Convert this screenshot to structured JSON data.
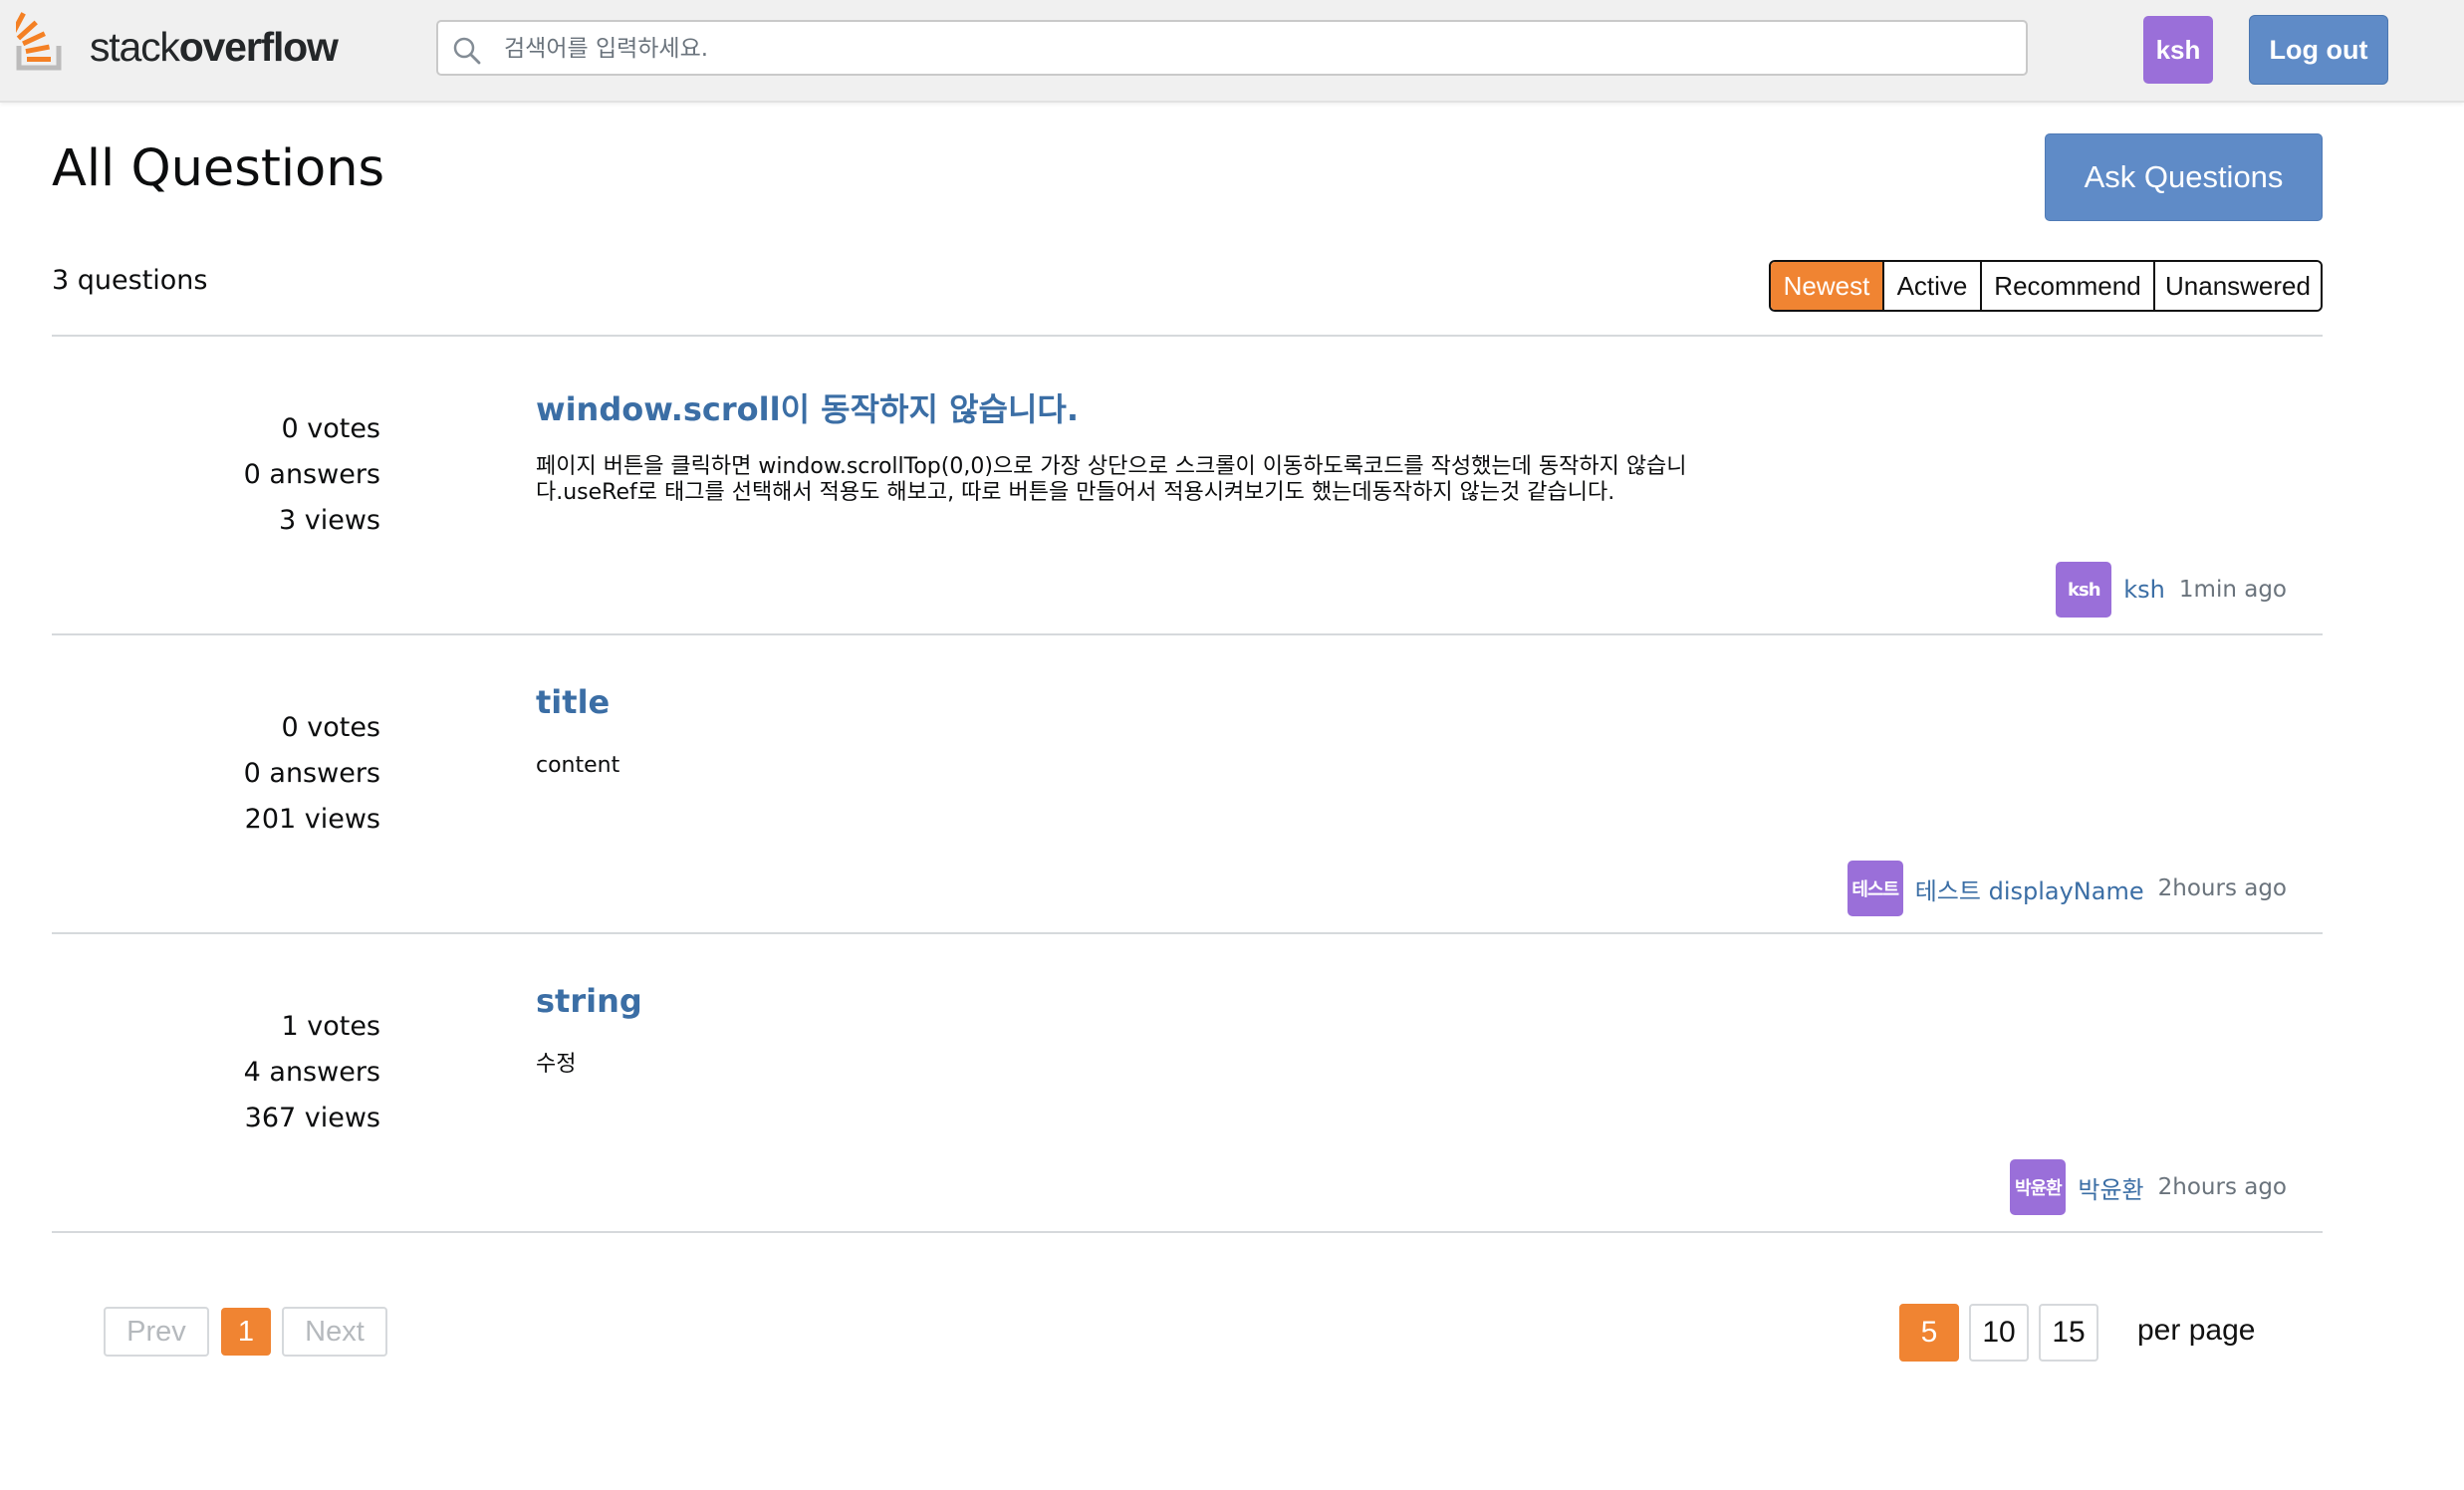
{
  "header": {
    "logo_light": "stack",
    "logo_bold": "overflow",
    "search_placeholder": "검색어를 입력하세요.",
    "user_avatar": "ksh",
    "logout_label": "Log out"
  },
  "main": {
    "title": "All Questions",
    "ask_label": "Ask Questions",
    "count_text": "3 questions",
    "sort_tabs": [
      {
        "label": "Newest",
        "active": true
      },
      {
        "label": "Active",
        "active": false
      },
      {
        "label": "Recommend",
        "active": false
      },
      {
        "label": "Unanswered",
        "active": false
      }
    ],
    "questions": [
      {
        "votes": "0 votes",
        "answers": "0 answers",
        "views": "3 views",
        "title": "window.scroll이 동작하지 않습니다.",
        "body_line1": "페이지 버튼을 클릭하면 window.scrollTop(0,0)으로 가장 상단으로 스크롤이 이동하도록코드를 작성했는데 동작하지 않습니",
        "body_line2": "다.useRef로 태그를 선택해서 적용도 해보고, 따로 버튼을 만들어서 적용시켜보기도 했는데동작하지 않는것 같습니다.",
        "author_avatar": "ksh",
        "author": "ksh",
        "time": "1min ago"
      },
      {
        "votes": "0 votes",
        "answers": "0 answers",
        "views": "201 views",
        "title": "title",
        "body_line1": "content",
        "body_line2": "",
        "author_avatar": "테스트",
        "author": "테스트 displayName",
        "time": "2hours ago"
      },
      {
        "votes": "1 votes",
        "answers": "4 answers",
        "views": "367 views",
        "title": "string",
        "body_line1": "수정",
        "body_line2": "",
        "author_avatar": "박윤환",
        "author": "박윤환",
        "time": "2hours ago"
      }
    ]
  },
  "pagination": {
    "prev_label": "Prev",
    "current_page": "1",
    "next_label": "Next",
    "page_sizes": [
      "5",
      "10",
      "15"
    ],
    "active_size": "5",
    "per_page_label": "per page"
  },
  "colors": {
    "accent_orange": "#f08432",
    "primary_blue": "#5f8bc7",
    "link_blue": "#3b6ea5",
    "avatar_purple": "#9a6fd9"
  }
}
